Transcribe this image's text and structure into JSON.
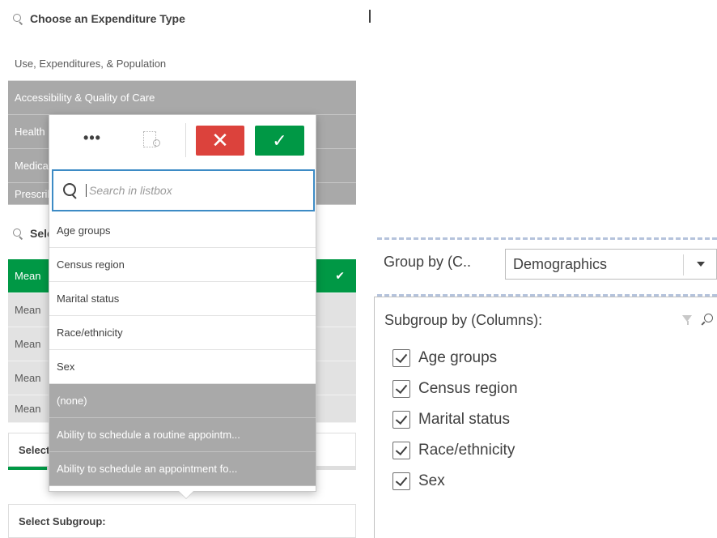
{
  "expenditure_section": {
    "header": "Choose an Expenditure Type",
    "items": [
      {
        "label": "Use, Expenditures, & Population",
        "state": "plain"
      },
      {
        "label": "Accessibility & Quality of Care",
        "state": "dark"
      },
      {
        "label": "Health Insurance",
        "state": "dark"
      },
      {
        "label": "Medical Conditions",
        "state": "dark"
      },
      {
        "label": "Prescribed Drugs",
        "state": "dark"
      }
    ]
  },
  "statistic_section": {
    "header": "Select Statistic",
    "items": [
      {
        "label": "Mean",
        "selected": true
      },
      {
        "label": "Mean",
        "selected": false
      },
      {
        "label": "Mean",
        "selected": false
      },
      {
        "label": "Mean",
        "selected": false
      },
      {
        "label": "Mean",
        "selected": false
      }
    ]
  },
  "select_boxes": {
    "first": "Select",
    "subgroup": "Select Subgroup:"
  },
  "popup": {
    "more_label": "•••",
    "cancel_label": "✕",
    "confirm_label": "✓",
    "search_placeholder": "Search in listbox",
    "items": [
      {
        "label": "Age groups",
        "state": "option"
      },
      {
        "label": "Census region",
        "state": "option"
      },
      {
        "label": "Marital status",
        "state": "option"
      },
      {
        "label": "Race/ethnicity",
        "state": "option"
      },
      {
        "label": "Sex",
        "state": "option"
      },
      {
        "label": "(none)",
        "state": "alternative"
      },
      {
        "label": "Ability to schedule a routine appointm...",
        "state": "alternative"
      },
      {
        "label": "Ability to schedule an appointment fo...",
        "state": "alternative"
      }
    ]
  },
  "group_by": {
    "label": "Group by (C..",
    "selected": "Demographics"
  },
  "subgroup_panel": {
    "title": "Subgroup by (Columns):",
    "items": [
      {
        "label": "Age groups",
        "checked": true
      },
      {
        "label": "Census region",
        "checked": true
      },
      {
        "label": "Marital status",
        "checked": true
      },
      {
        "label": "Race/ethnicity",
        "checked": true
      },
      {
        "label": "Sex",
        "checked": true
      }
    ]
  },
  "colors": {
    "selected_green": "#009845",
    "cancel_red": "#dc423c",
    "alternative_gray": "#a9a9a9",
    "focus_blue": "#3d8bc5"
  }
}
